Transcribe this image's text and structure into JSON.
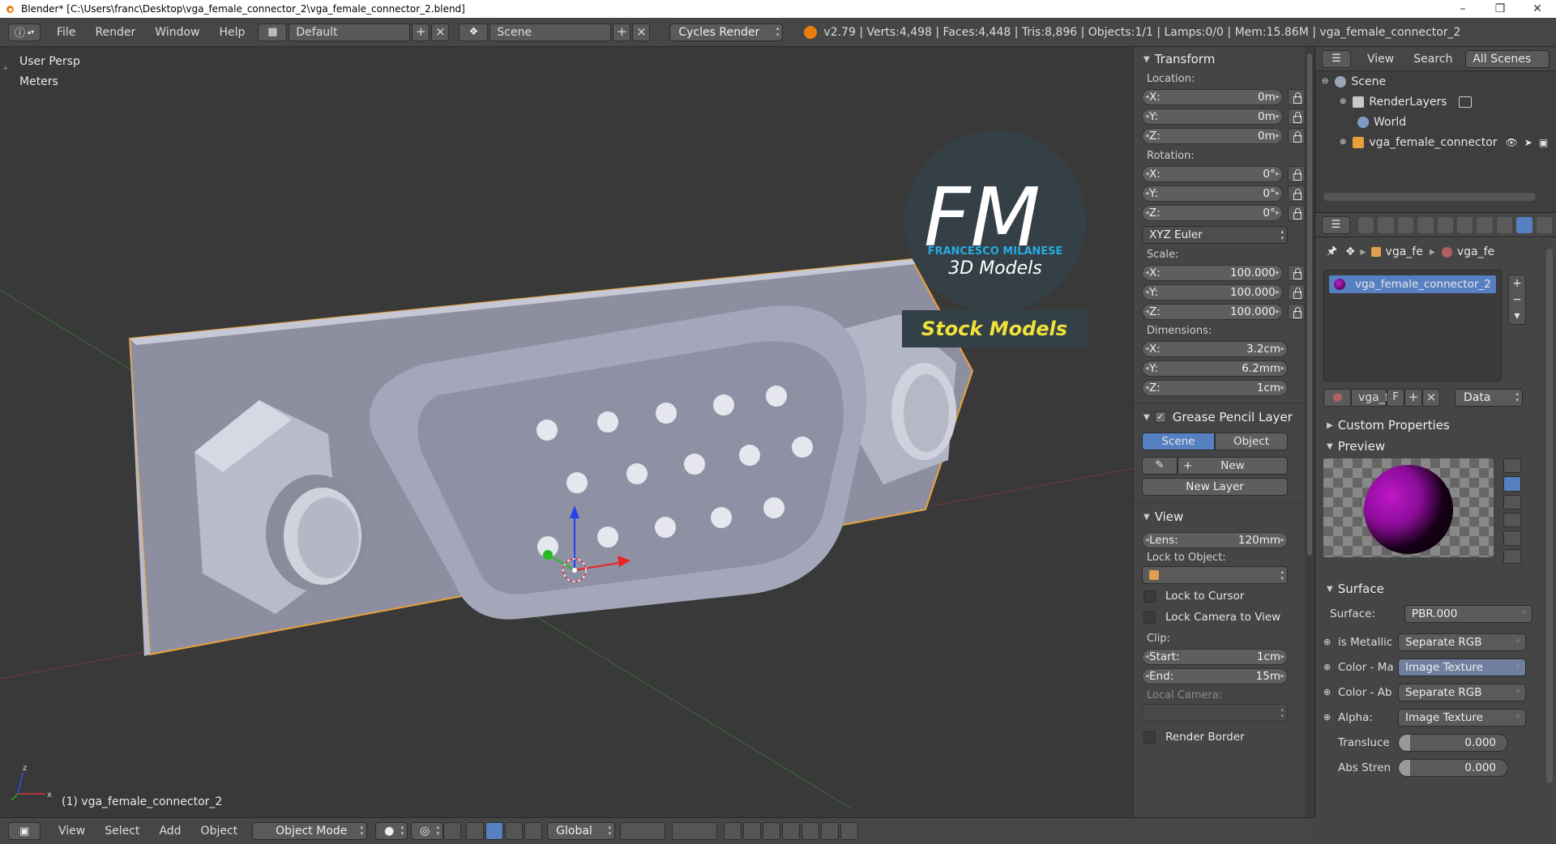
{
  "window": {
    "title": "Blender* [C:\\Users\\franc\\Desktop\\vga_female_connector_2\\vga_female_connector_2.blend]",
    "minimize": "–",
    "maximize": "❐",
    "close": "✕"
  },
  "topbar": {
    "menus": [
      "File",
      "Render",
      "Window",
      "Help"
    ],
    "screen_layout": "Default",
    "scene": "Scene",
    "render_engine": "Cycles Render",
    "stats": "v2.79 | Verts:4,498 | Faces:4,448 | Tris:8,896 | Objects:1/1 | Lamps:0/0 | Mem:15.86M | vga_female_connector_2"
  },
  "viewport": {
    "view_name": "User Persp",
    "units": "Meters",
    "object_label": "(1) vga_female_connector_2",
    "logo_letters": "FM",
    "logo_name": "FRANCESCO MILANESE",
    "logo_sub": "3D Models",
    "logo_banner": "Stock Models"
  },
  "npanel": {
    "transform_title": "Transform",
    "location_label": "Location:",
    "location": [
      {
        "axis": "X:",
        "value": "0m"
      },
      {
        "axis": "Y:",
        "value": "0m"
      },
      {
        "axis": "Z:",
        "value": "0m"
      }
    ],
    "rotation_label": "Rotation:",
    "rotation": [
      {
        "axis": "X:",
        "value": "0°"
      },
      {
        "axis": "Y:",
        "value": "0°"
      },
      {
        "axis": "Z:",
        "value": "0°"
      }
    ],
    "rotation_mode": "XYZ Euler",
    "scale_label": "Scale:",
    "scale": [
      {
        "axis": "X:",
        "value": "100.000"
      },
      {
        "axis": "Y:",
        "value": "100.000"
      },
      {
        "axis": "Z:",
        "value": "100.000"
      }
    ],
    "dimensions_label": "Dimensions:",
    "dimensions": [
      {
        "axis": "X:",
        "value": "3.2cm"
      },
      {
        "axis": "Y:",
        "value": "6.2mm"
      },
      {
        "axis": "Z:",
        "value": "1cm"
      }
    ],
    "grease_title": "Grease Pencil Layer",
    "grease_tab_scene": "Scene",
    "grease_tab_object": "Object",
    "grease_new": "New",
    "grease_new_layer": "New Layer",
    "view_title": "View",
    "lens_label": "Lens:",
    "lens_value": "120mm",
    "lock_object_label": "Lock to Object:",
    "lock_cursor": "Lock to Cursor",
    "lock_camera": "Lock Camera to View",
    "clip_label": "Clip:",
    "clip_start_label": "Start:",
    "clip_start": "1cm",
    "clip_end_label": "End:",
    "clip_end": "15m",
    "local_camera_label": "Local Camera:",
    "render_border": "Render Border"
  },
  "outliner": {
    "menus": [
      "View",
      "Search"
    ],
    "filter": "All Scenes",
    "items": [
      "Scene",
      "RenderLayers",
      "World",
      "vga_female_connector"
    ]
  },
  "properties": {
    "breadcrumb": [
      "vga_fe",
      "vga_fe"
    ],
    "material_slot": "vga_female_connector_2",
    "datablock_name": "vga_f",
    "datablock_f": "F",
    "link_mode": "Data",
    "custom_props": "Custom Properties",
    "preview": "Preview",
    "surface_title": "Surface",
    "surface_label": "Surface:",
    "surface_value": "PBR.000",
    "inputs": [
      {
        "label": "is Metallic",
        "value": "Separate RGB",
        "hi": false
      },
      {
        "label": "Color - Ma",
        "value": "Image Texture",
        "hi": true
      },
      {
        "label": "Color - Ab",
        "value": "Separate RGB",
        "hi": false
      },
      {
        "label": "Alpha:",
        "value": "Image Texture",
        "hi": false
      }
    ],
    "translucency_label": "Transluce",
    "translucency_value": "0.000",
    "abs_label": "Abs Stren",
    "abs_value": "0.000"
  },
  "bottombar": {
    "menus": [
      "View",
      "Select",
      "Add",
      "Object"
    ],
    "mode": "Object Mode",
    "orientation": "Global"
  },
  "colors": {
    "accent_blue": "#5680c2",
    "object_outline": "#e8a03c",
    "logo_cyan": "#2aa9e0",
    "banner_yellow": "#f0e23a"
  }
}
